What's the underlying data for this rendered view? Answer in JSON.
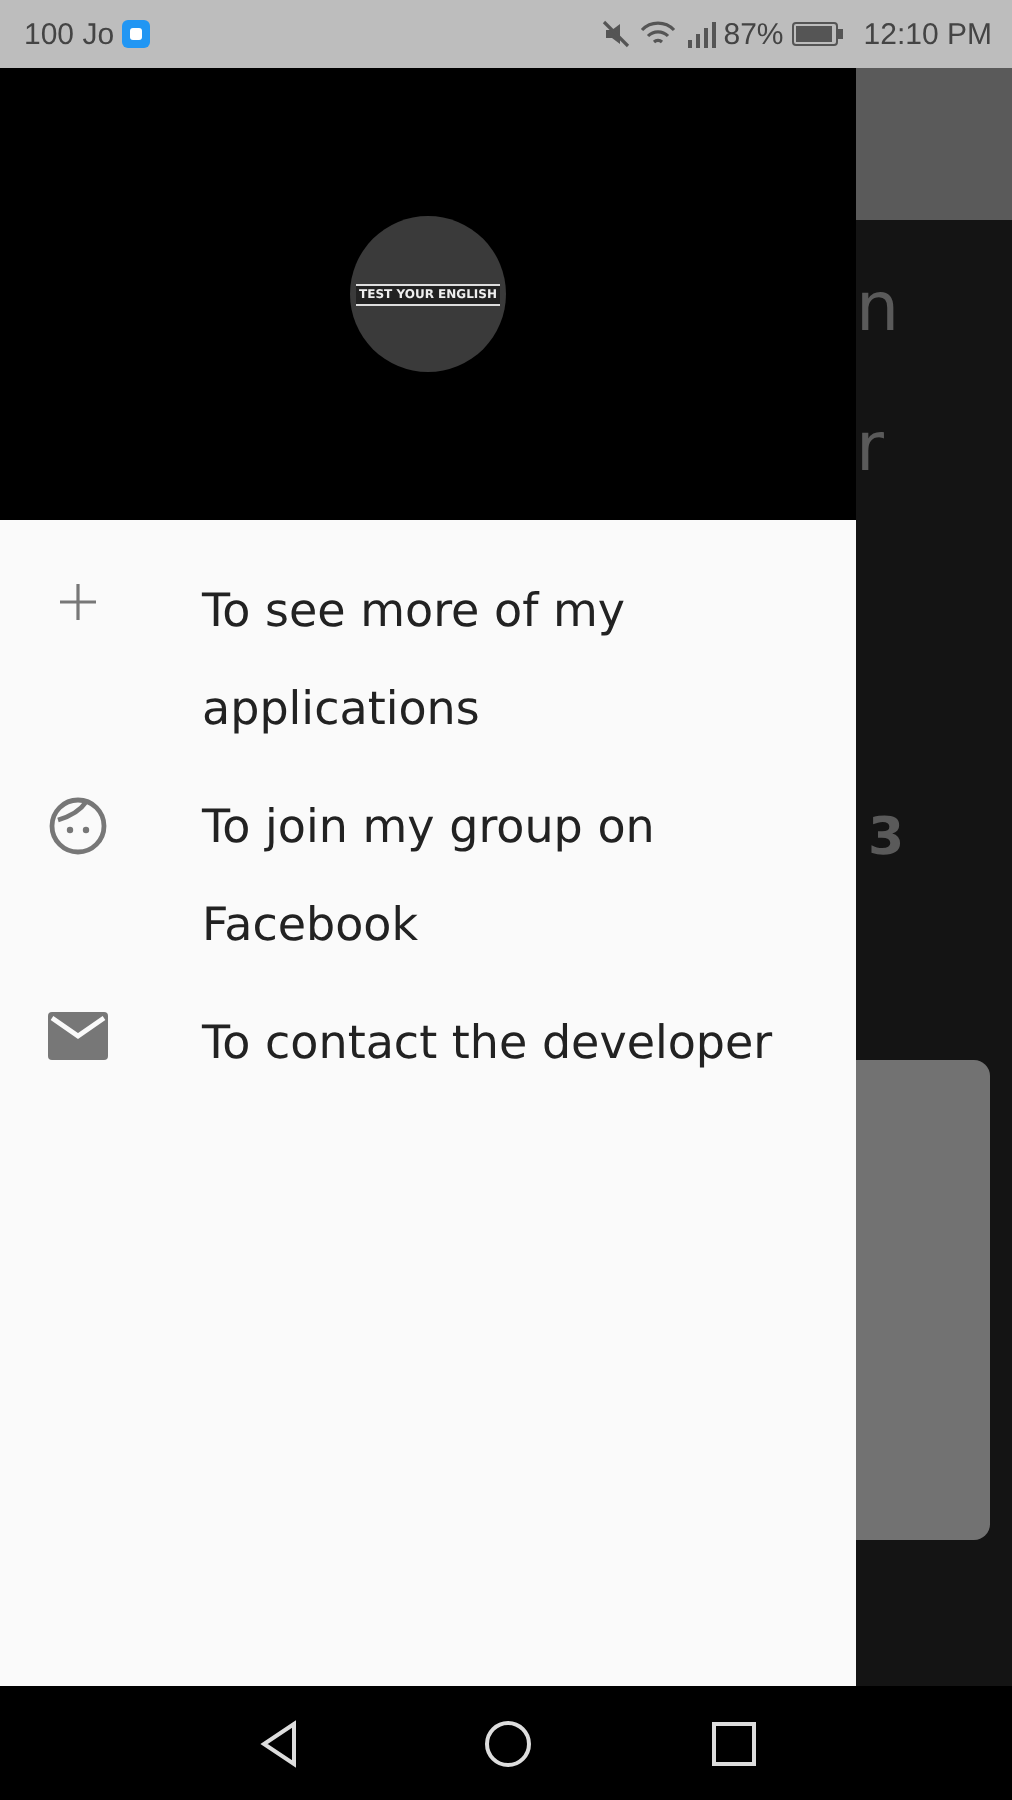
{
  "status_bar": {
    "left_text": "100 Jo",
    "battery": "87%",
    "time": "12:10 PM"
  },
  "drawer": {
    "logo_text": "TEST YOUR ENGLISH",
    "items": [
      {
        "kind": "plus",
        "label": "To see more of my applications"
      },
      {
        "kind": "face",
        "label": "To join my group on Facebook"
      },
      {
        "kind": "mail",
        "label": "To contact the developer"
      }
    ]
  },
  "background": {
    "fragments": [
      "n",
      "r",
      "3"
    ]
  }
}
